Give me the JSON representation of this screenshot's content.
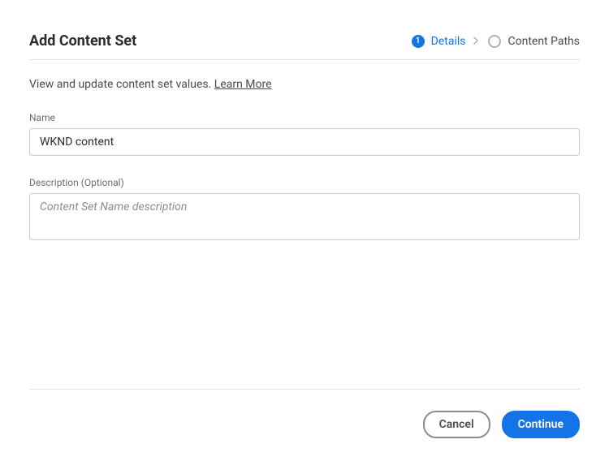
{
  "header": {
    "title": "Add Content Set"
  },
  "stepper": {
    "step1": {
      "number": "1",
      "label": "Details"
    },
    "step2": {
      "label": "Content Paths"
    }
  },
  "intro": {
    "text": "View and update content set values. ",
    "learn_more": "Learn More"
  },
  "fields": {
    "name": {
      "label": "Name",
      "value": "WKND content"
    },
    "description": {
      "label": "Description (Optional)",
      "placeholder": "Content Set Name description",
      "value": ""
    }
  },
  "footer": {
    "cancel": "Cancel",
    "continue": "Continue"
  }
}
